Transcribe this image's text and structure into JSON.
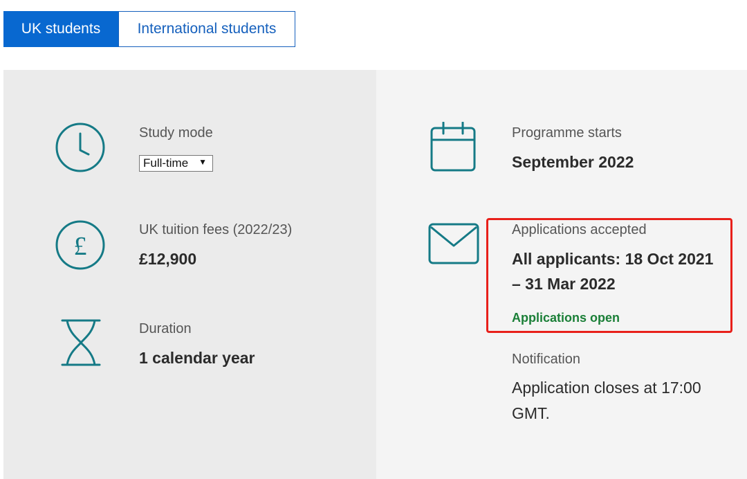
{
  "tabs": {
    "uk": "UK students",
    "international": "International students"
  },
  "study_mode": {
    "label": "Study mode",
    "selected": "Full-time"
  },
  "fees": {
    "label": "UK tuition fees (2022/23)",
    "value": "£12,900"
  },
  "duration": {
    "label": "Duration",
    "value": "1 calendar year"
  },
  "programme": {
    "label": "Programme starts",
    "value": "September 2022"
  },
  "applications": {
    "label": "Applications accepted",
    "value": "All applicants: 18 Oct 2021 – 31 Mar 2022",
    "status": "Applications open"
  },
  "notification": {
    "label": "Notification",
    "text": "Application closes at 17:00 GMT."
  },
  "colors": {
    "accent_blue": "#0868d0",
    "icon_teal": "#157a86",
    "status_green": "#1a7f37",
    "highlight_red": "#e8201a"
  },
  "icons": [
    "clock-icon",
    "pound-icon",
    "hourglass-icon",
    "calendar-icon",
    "envelope-icon"
  ]
}
